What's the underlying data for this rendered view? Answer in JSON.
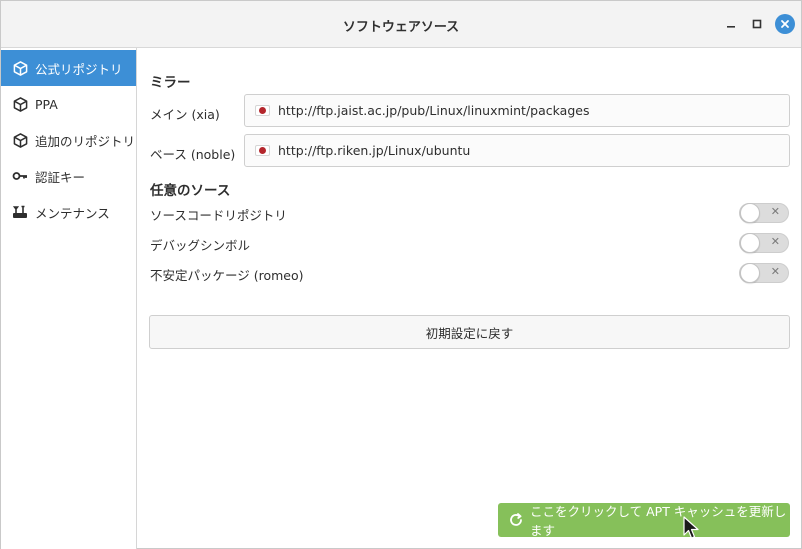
{
  "window": {
    "title": "ソフトウェアソース"
  },
  "sidebar": {
    "items": [
      {
        "label": "公式リポジトリ",
        "icon": "package-icon",
        "active": true
      },
      {
        "label": "PPA",
        "icon": "package-icon",
        "active": false
      },
      {
        "label": "追加のリポジトリ",
        "icon": "package-icon",
        "active": false
      },
      {
        "label": "認証キー",
        "icon": "key-icon",
        "active": false
      },
      {
        "label": "メンテナンス",
        "icon": "tools-icon",
        "active": false
      }
    ]
  },
  "mirrors": {
    "heading": "ミラー",
    "main": {
      "label": "メイン (xia)",
      "url": "http://ftp.jaist.ac.jp/pub/Linux/linuxmint/packages",
      "flag": "japan-flag-icon"
    },
    "base": {
      "label": "ベース (noble)",
      "url": "http://ftp.riken.jp/Linux/ubuntu",
      "flag": "japan-flag-icon"
    }
  },
  "optional": {
    "heading": "任意のソース",
    "items": [
      {
        "label": "ソースコードリポジトリ",
        "enabled": false
      },
      {
        "label": "デバッグシンボル",
        "enabled": false
      },
      {
        "label": "不安定パッケージ (romeo)",
        "enabled": false
      }
    ]
  },
  "reset_button": {
    "label": "初期設定に戻す"
  },
  "update_button": {
    "label": "ここをクリックして APT キャッシュを更新します",
    "icon": "refresh-icon"
  },
  "colors": {
    "accent": "#3d8fd6",
    "update_green": "#86c05a",
    "titlebar": "#f3f3f3"
  }
}
